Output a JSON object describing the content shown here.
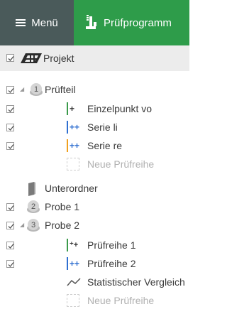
{
  "header": {
    "menu_label": "Menü",
    "program_label": "Prüfprogramm"
  },
  "project": {
    "label": "Projekt"
  },
  "tree": {
    "pruefteil": "Prüfteil",
    "einzelpunkt": "Einzelpunkt vo",
    "serie_li": "Serie li",
    "serie_re": "Serie re",
    "neue_pruefreihe_1": "Neue Prüfreihe",
    "unterordner": "Unterordner",
    "probe1": "Probe 1",
    "probe1_num": "2",
    "probe2": "Probe 2",
    "probe2_num": "3",
    "pruefteil_num": "1",
    "pruefreihe1": "Prüfreihe 1",
    "pruefreihe2": "Prüfreihe 2",
    "statistischer": "Statistischer Vergleich",
    "neue_pruefreihe_2": "Neue Prüfreihe"
  },
  "colors": {
    "menu_bg": "#4a5a5a",
    "program_bg": "#2e9c4a",
    "project_row_bg": "#ececec",
    "green_marker": "#3a9a4a",
    "blue_marker": "#2f6fd0",
    "orange_marker": "#f0a020"
  }
}
